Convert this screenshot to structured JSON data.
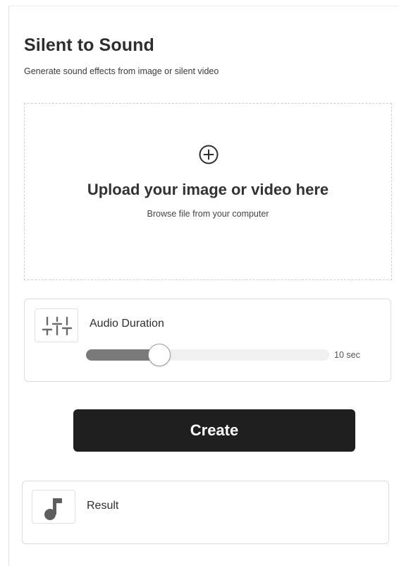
{
  "app": {
    "title": "Silent to Sound",
    "subtitle": "Generate sound effects from image or silent video"
  },
  "upload": {
    "icon": "plus-circle-icon",
    "title": "Upload your image or video here",
    "hint": "Browse file from your computer"
  },
  "duration": {
    "icon": "sliders-icon",
    "label": "Audio Duration",
    "value_text": "10 sec",
    "slider_fraction": 0.3
  },
  "actions": {
    "create_label": "Create"
  },
  "result": {
    "icon": "music-note-icon",
    "label": "Result"
  }
}
